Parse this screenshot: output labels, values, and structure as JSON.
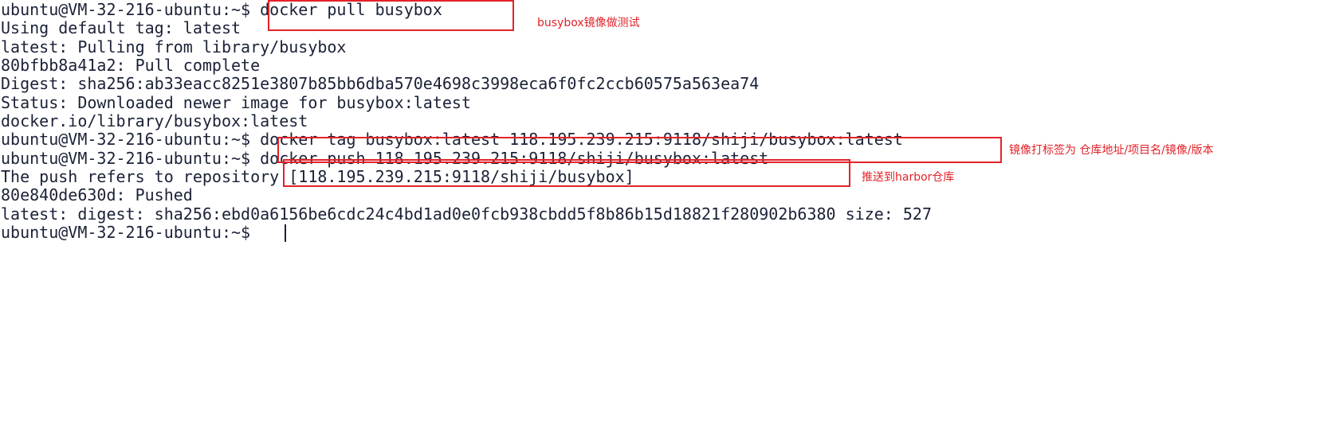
{
  "terminal": {
    "lines": [
      "ubuntu@VM-32-216-ubuntu:~$ docker pull busybox",
      "Using default tag: latest",
      "latest: Pulling from library/busybox",
      "80bfbb8a41a2: Pull complete",
      "Digest: sha256:ab33eacc8251e3807b85bb6dba570e4698c3998eca6f0fc2ccb60575a563ea74",
      "Status: Downloaded newer image for busybox:latest",
      "docker.io/library/busybox:latest",
      "ubuntu@VM-32-216-ubuntu:~$ docker tag busybox:latest 118.195.239.215:9118/shiji/busybox:latest",
      "ubuntu@VM-32-216-ubuntu:~$ docker push 118.195.239.215:9118/shiji/busybox:latest",
      "The push refers to repository [118.195.239.215:9118/shiji/busybox]",
      "80e840de630d: Pushed",
      "latest: digest: sha256:ebd0a6156be6cdc24c4bd1ad0e0fcb938cbdd5f8b86b15d18821f280902b6380 size: 527",
      "ubuntu@VM-32-216-ubuntu:~$ "
    ]
  },
  "annotations": {
    "pull_note": "busybox镜像做测试",
    "tag_note": "镜像打标签为 仓库地址/项目名/镜像/版本",
    "push_note": "推送到harbor仓库"
  },
  "colors": {
    "text": "#1b2237",
    "annotation": "#e32229",
    "background": "#ffffff"
  }
}
